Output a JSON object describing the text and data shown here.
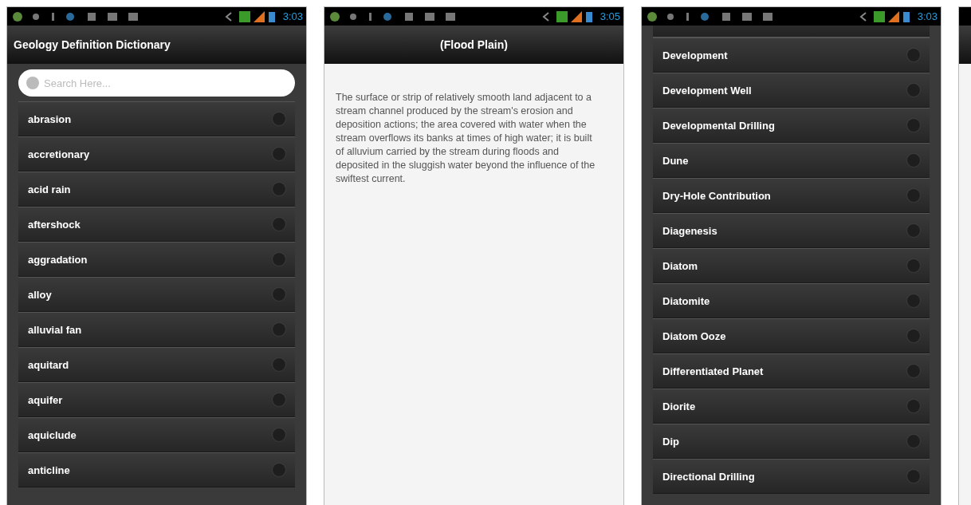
{
  "screens": [
    {
      "kind": "list",
      "time": "3:03",
      "title": "Geology Definition Dictionary",
      "search": {
        "placeholder": "Search Here..."
      },
      "items": [
        "abrasion",
        "accretionary",
        "acid rain",
        "aftershock",
        "aggradation",
        "alloy",
        "alluvial fan",
        "aquitard",
        "aquifer",
        "aquiclude",
        "anticline"
      ]
    },
    {
      "kind": "detail",
      "time": "3:05",
      "title": "(Flood Plain)",
      "body": "The surface or strip of relatively smooth land adjacent to a stream channel produced by the stream's erosion and deposition actions; the area covered with water when the stream overflows its banks at times of high water; it is built of alluvium carried by the stream during floods and deposited in the sluggish water beyond the influence of the swiftest current."
    },
    {
      "kind": "list",
      "time": "3:03",
      "items": [
        "Development",
        "Development Well",
        "Developmental Drilling",
        "Dune",
        "Dry-Hole Contribution",
        "Diagenesis",
        "Diatom",
        "Diatomite",
        "Diatom Ooze",
        "Differentiated Planet",
        "Diorite",
        "Dip",
        "Directional Drilling"
      ]
    },
    {
      "kind": "partial"
    }
  ]
}
